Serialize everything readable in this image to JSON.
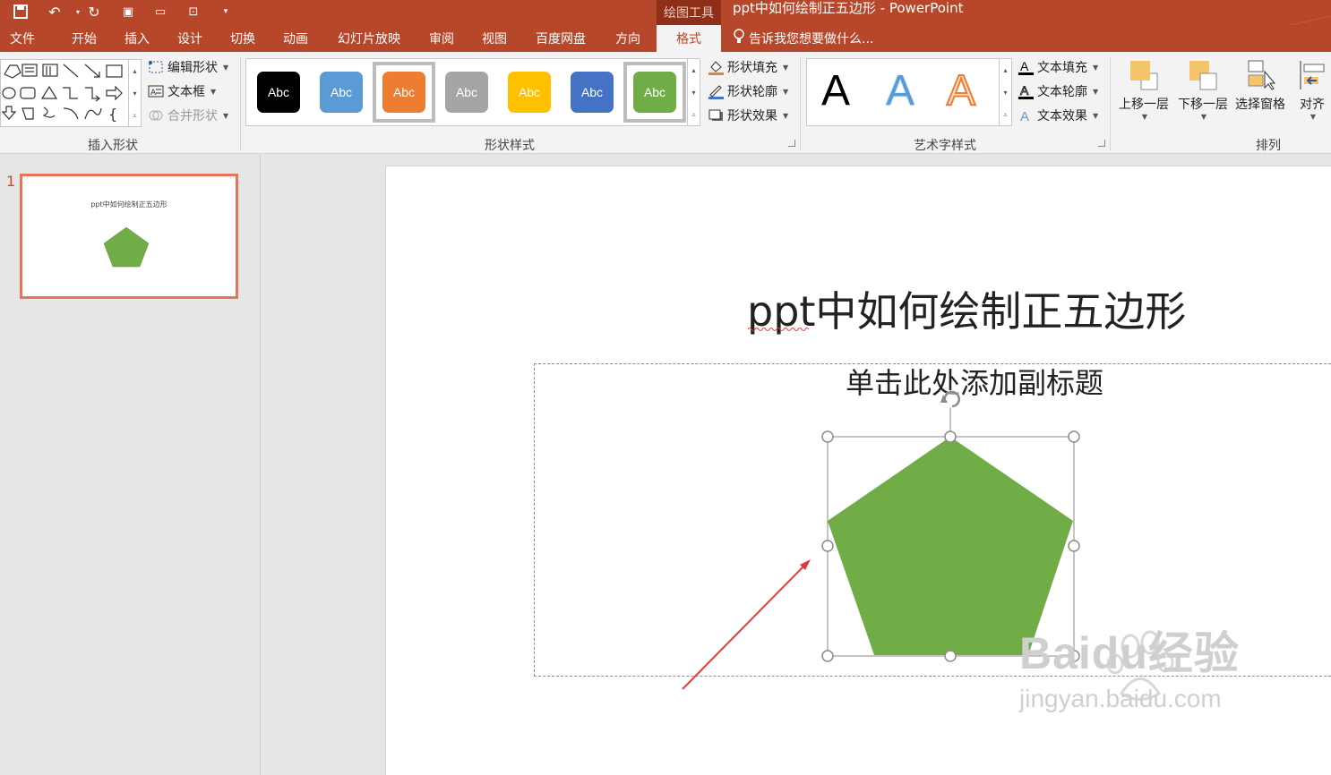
{
  "titlebar": {
    "context_tab": "绘图工具",
    "window_title": "ppt中如何绘制正五边形 - PowerPoint",
    "quick_access": [
      "save-icon",
      "undo-icon",
      "redo-icon",
      "present-icon",
      "comment-icon",
      "touch-mode-icon",
      "customize-icon"
    ]
  },
  "tabs": [
    "文件",
    "开始",
    "插入",
    "设计",
    "切换",
    "动画",
    "幻灯片放映",
    "审阅",
    "视图",
    "百度网盘",
    "方向",
    "格式"
  ],
  "active_tab": "格式",
  "tell_me": "告诉我您想要做什么...",
  "ribbon": {
    "insert_shapes": {
      "label": "插入形状",
      "edit_shape": "编辑形状",
      "text_box": "文本框",
      "merge_shapes": "合并形状"
    },
    "shape_styles": {
      "label": "形状样式",
      "swatches": [
        {
          "text": "Abc",
          "color": "#000000"
        },
        {
          "text": "Abc",
          "color": "#5b9bd5"
        },
        {
          "text": "Abc",
          "color": "#ed7d31"
        },
        {
          "text": "Abc",
          "color": "#a5a5a5"
        },
        {
          "text": "Abc",
          "color": "#ffc000"
        },
        {
          "text": "Abc",
          "color": "#4472c4"
        },
        {
          "text": "Abc",
          "color": "#70ad47"
        }
      ],
      "fill": "形状填充",
      "outline": "形状轮廓",
      "effects": "形状效果"
    },
    "wordart": {
      "label": "艺术字样式",
      "samples": [
        "A",
        "A",
        "A"
      ],
      "text_fill": "文本填充",
      "text_outline": "文本轮廓",
      "text_effects": "文本效果"
    },
    "arrange": {
      "label": "排列",
      "bring_forward": "上移一层",
      "send_backward": "下移一层",
      "selection_pane": "选择窗格",
      "align": "对齐"
    }
  },
  "slides_pane": {
    "slide_number": "1",
    "thumb_title": "ppt中如何绘制正五边形"
  },
  "slide": {
    "title": "ppt中如何绘制正五边形",
    "subtitle_placeholder": "单击此处添加副标题",
    "pentagon_color": "#70ad47"
  },
  "watermark": {
    "main": "Baidu经验",
    "sub": "jingyan.baidu.com"
  },
  "colors": {
    "accent": "#b7472a",
    "annotation_arrow": "#e03a3a"
  }
}
